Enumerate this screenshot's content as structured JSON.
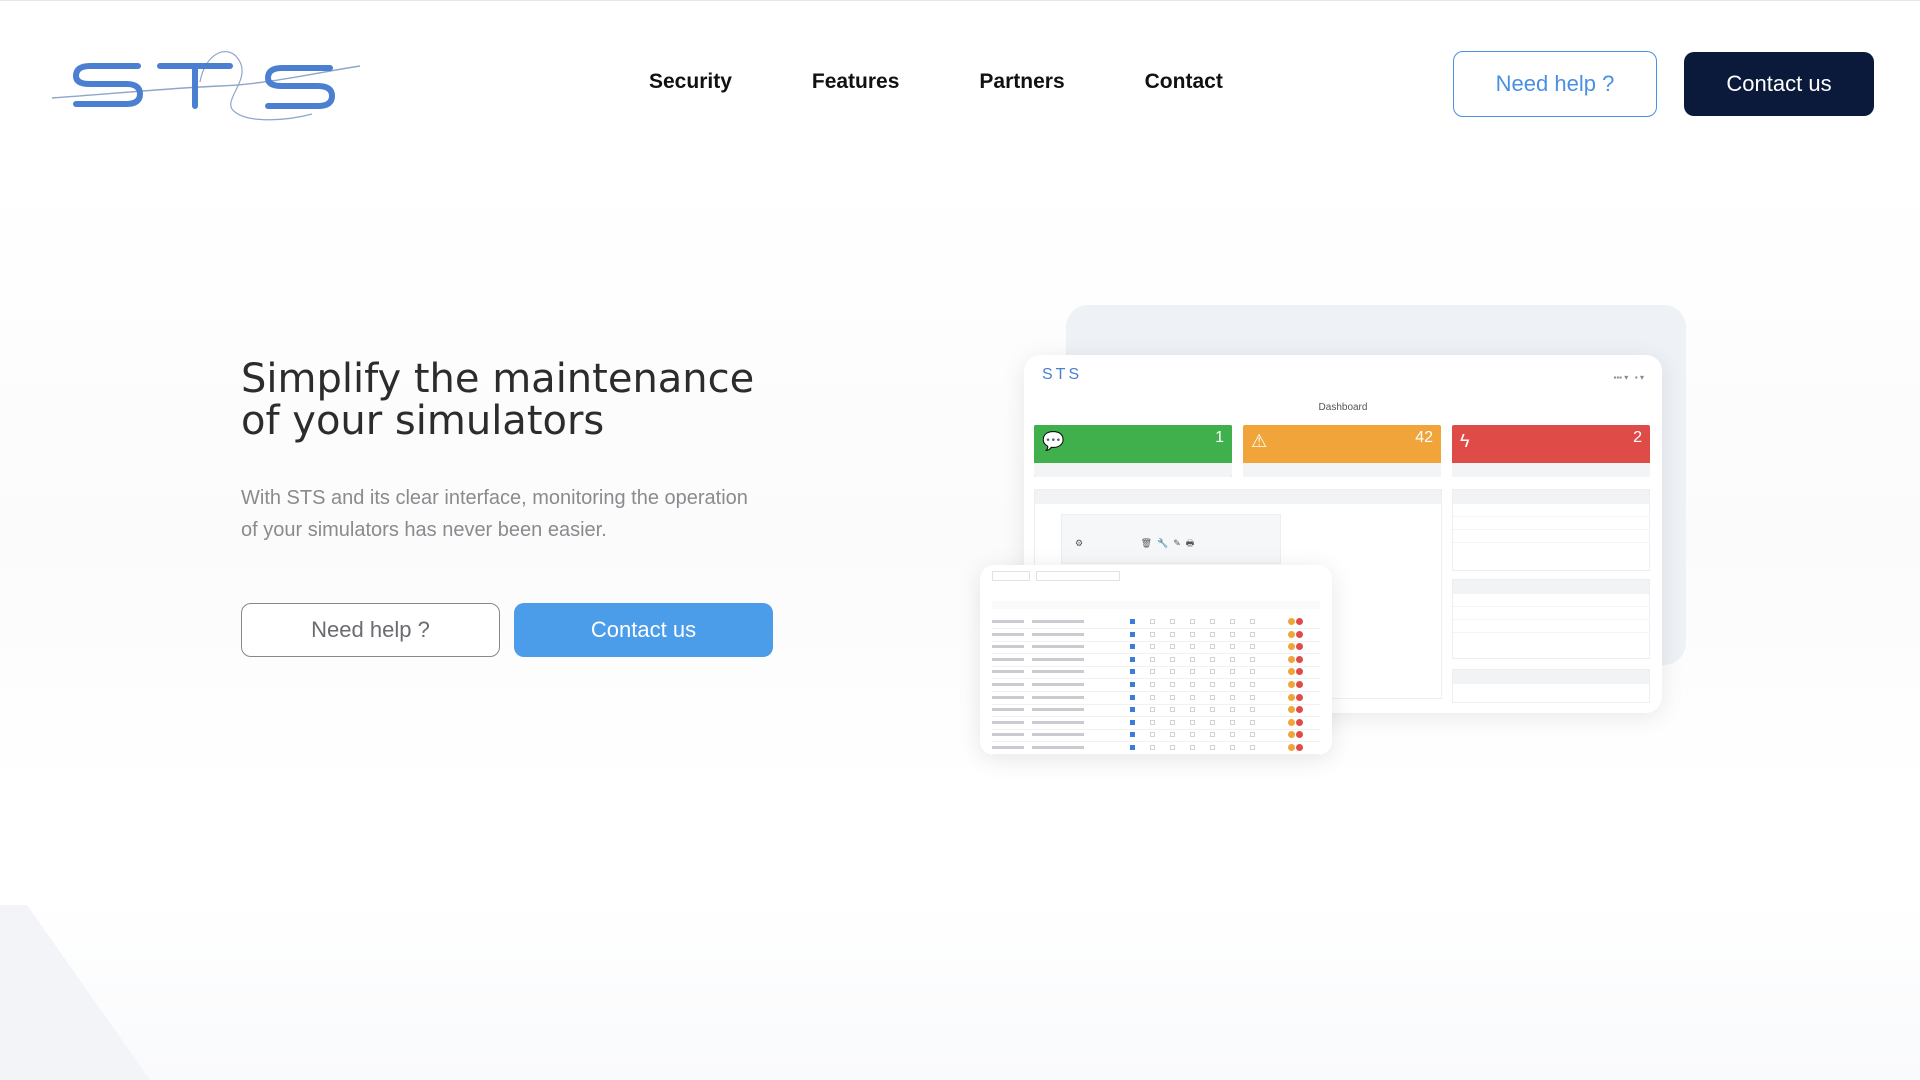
{
  "brand": {
    "logo_text": "STS",
    "accent": "#4a90e2",
    "navy": "#0b1a3b"
  },
  "nav": {
    "items": [
      "Security",
      "Features",
      "Partners",
      "Contact"
    ]
  },
  "header": {
    "help_label": "Need help ?",
    "contact_label": "Contact us"
  },
  "hero": {
    "title_line1": "Simplify the maintenance",
    "title_line2": "of your simulators",
    "subtitle_line1": "With STS and its clear interface, monitoring the operation",
    "subtitle_line2": "of your simulators has never been easier.",
    "help_label": "Need help ?",
    "contact_label": "Contact us",
    "contact_color": "#4b9ce9"
  },
  "mockup": {
    "logo_text": "STS",
    "title": "Dashboard",
    "cards": [
      {
        "icon": "chat-icon",
        "value": "1",
        "color": "#3fb04b"
      },
      {
        "icon": "warning-icon",
        "value": "42",
        "color": "#f0a43a"
      },
      {
        "icon": "bolt-icon",
        "value": "2",
        "color": "#df4b47"
      }
    ]
  }
}
